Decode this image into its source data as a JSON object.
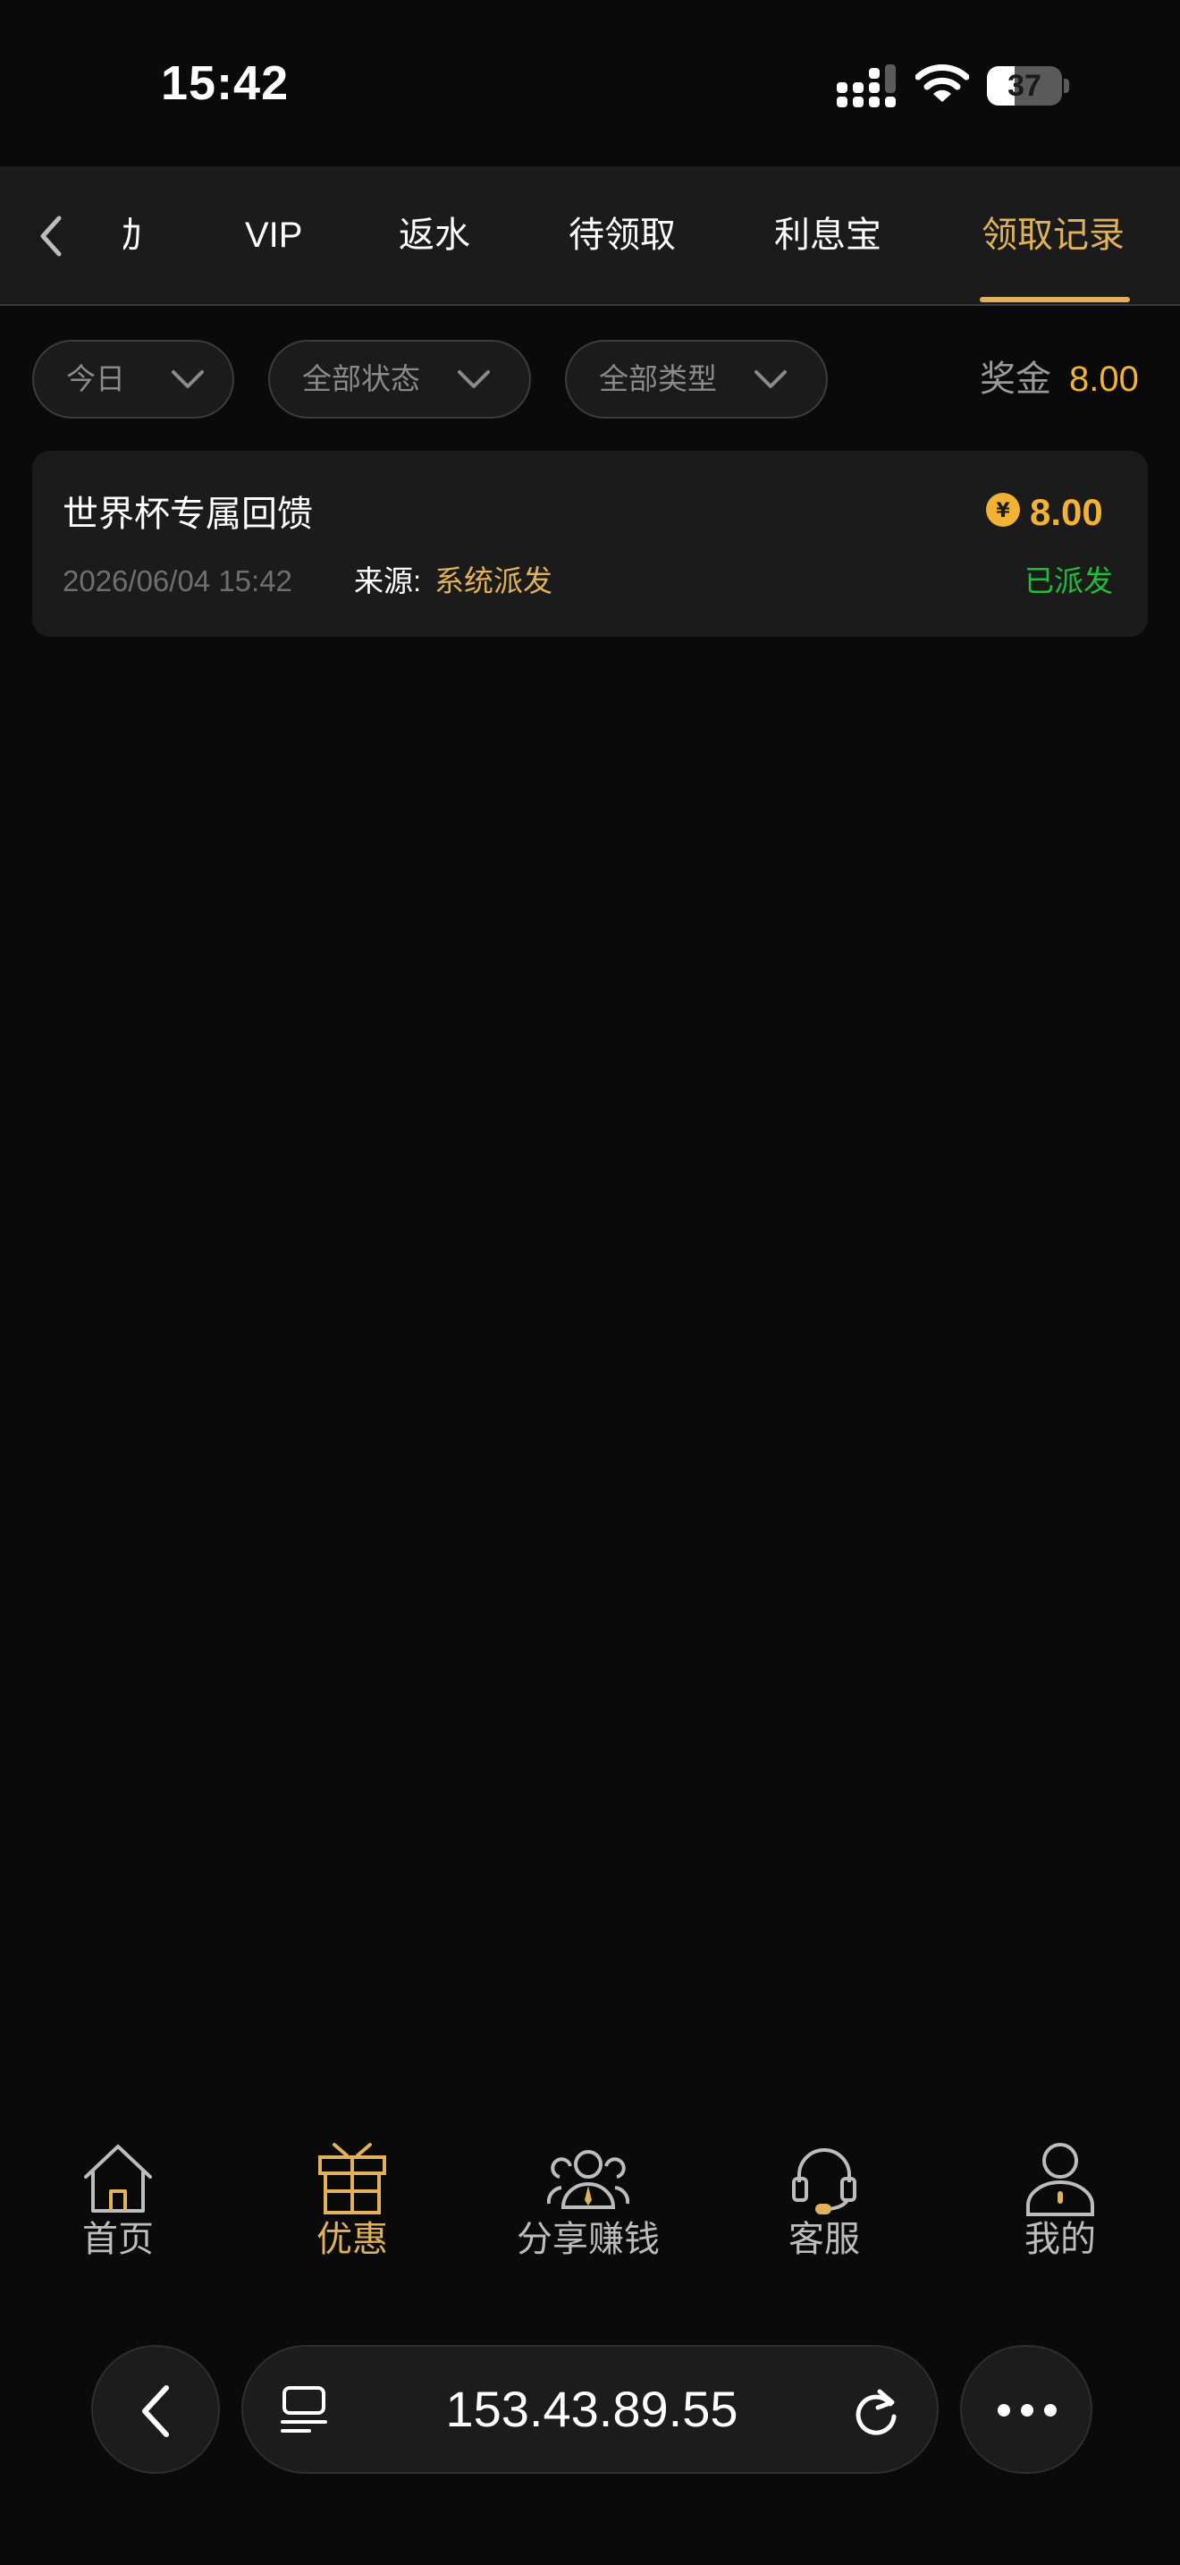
{
  "status_bar": {
    "time": "15:42",
    "battery_level": "37",
    "battery_fraction": 0.37,
    "icons": [
      "signal-icon",
      "wifi-icon",
      "battery-icon"
    ]
  },
  "tabs": [
    {
      "label": "动",
      "active": false
    },
    {
      "label": "VIP",
      "active": false
    },
    {
      "label": "返水",
      "active": false
    },
    {
      "label": "待领取",
      "active": false
    },
    {
      "label": "利息宝",
      "active": false
    },
    {
      "label": "领取记录",
      "active": true
    }
  ],
  "filters": {
    "date": "今日",
    "status": "全部状态",
    "type": "全部类型"
  },
  "bonus": {
    "label": "奖金",
    "value": "8.00"
  },
  "records": [
    {
      "title": "世界杯专属回馈",
      "currency_symbol": "¥",
      "amount": "8.00",
      "datetime": "2026/06/04 15:42",
      "source_label": "来源:",
      "source_value": "系统派发",
      "status": "已派发"
    }
  ],
  "bottom_nav": [
    {
      "label": "首页",
      "icon": "home-icon",
      "active": false
    },
    {
      "label": "优惠",
      "icon": "gift-icon",
      "active": true
    },
    {
      "label": "分享赚钱",
      "icon": "share-earn-icon",
      "active": false
    },
    {
      "label": "客服",
      "icon": "headset-icon",
      "active": false
    },
    {
      "label": "我的",
      "icon": "profile-icon",
      "active": false
    }
  ],
  "browser": {
    "url": "153.43.89.55"
  },
  "colors": {
    "accent_gold": "#e0b25a",
    "amount_orange": "#f2b233",
    "status_green": "#1fbd3a",
    "background": "#0a0a0a",
    "surface": "#1b1b1b"
  }
}
